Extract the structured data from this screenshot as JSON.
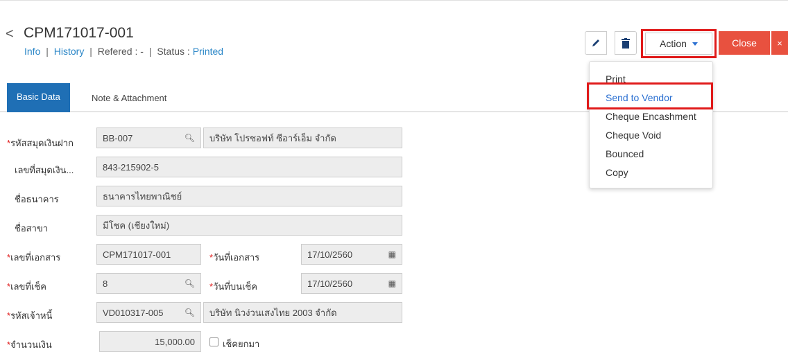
{
  "header": {
    "back_glyph": "<",
    "doc_title": "CPM171017-001",
    "link_info": "Info",
    "link_history": "History",
    "referred_label": "Refered : -",
    "status_label": "Status :",
    "status_value": "Printed",
    "sep": "|"
  },
  "toolbar": {
    "edit_icon": "pencil-icon",
    "delete_icon": "trash-icon",
    "action_label": "Action",
    "close_label": "Close",
    "x_label": "×"
  },
  "tabs": [
    {
      "label": "Basic Data",
      "active": true
    },
    {
      "label": "Note & Attachment",
      "active": false
    }
  ],
  "action_menu": {
    "items": [
      "Print",
      "Send to Vendor",
      "Cheque Encashment",
      "Cheque Void",
      "Bounced",
      "Copy"
    ],
    "highlighted": "Send to Vendor"
  },
  "form": {
    "bank_book_code": {
      "label": "รหัสสมุดเงินฝาก",
      "required": true,
      "value": "BB-007",
      "name_value": "บริษัท โปรซอฟท์ ซีอาร์เอ็ม จำกัด"
    },
    "bank_book_no": {
      "label": "เลขที่สมุดเงิน...",
      "required": false,
      "value": "843-215902-5"
    },
    "bank_name": {
      "label": "ชื่อธนาคาร",
      "required": false,
      "value": "ธนาคารไทยพาณิชย์"
    },
    "branch_name": {
      "label": "ชื่อสาขา",
      "required": false,
      "value": "มีโชค (เชียงใหม่)"
    },
    "doc_no": {
      "label": "เลขที่เอกสาร",
      "required": true,
      "value": "CPM171017-001"
    },
    "doc_date": {
      "label": "วันที่เอกสาร",
      "required": true,
      "value": "17/10/2560"
    },
    "cheque_no": {
      "label": "เลขที่เช็ค",
      "required": true,
      "value": "8"
    },
    "cheque_date": {
      "label": "วันที่บนเช็ค",
      "required": true,
      "value": "17/10/2560"
    },
    "vendor_code": {
      "label": "รหัสเจ้าหนี้",
      "required": true,
      "value": "VD010317-005",
      "name_value": "บริษัท นิวง่วนเสงไทย 2003 จำกัด"
    },
    "amount": {
      "label": "จำนวนเงิน",
      "required": true,
      "value": "15,000.00"
    },
    "carried_cheque": {
      "label": "เช็คยกมา",
      "checked": false
    }
  },
  "req_mark": "*",
  "icons": {
    "search": "search-icon",
    "calendar": "calendar-icon"
  },
  "colors": {
    "accent": "#1f6fb5",
    "link": "#2a86c7",
    "close": "#e8513f",
    "highlight_border": "#e01a1a"
  }
}
